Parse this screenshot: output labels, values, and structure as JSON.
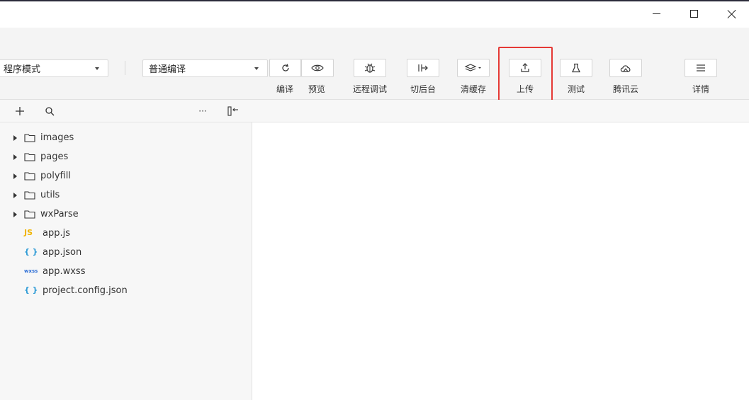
{
  "window": {
    "minimize_icon": "minimize-icon",
    "maximize_icon": "maximize-icon",
    "close_icon": "close-icon"
  },
  "toolbar": {
    "mode_select_value": "程序模式",
    "compile_select_value": "普通编译",
    "buttons": [
      {
        "label": "编译",
        "icon": "refresh-icon"
      },
      {
        "label": "预览",
        "icon": "eye-icon"
      },
      {
        "label": "远程调试",
        "icon": "bug-icon"
      },
      {
        "label": "切后台",
        "icon": "switch-background-icon"
      },
      {
        "label": "清缓存",
        "icon": "layers-icon"
      },
      {
        "label": "上传",
        "icon": "upload-icon"
      },
      {
        "label": "测试",
        "icon": "flask-icon"
      },
      {
        "label": "腾讯云",
        "icon": "cloud-icon"
      },
      {
        "label": "详情",
        "icon": "menu-icon"
      }
    ],
    "highlight_color": "#e53935"
  },
  "explorer": {
    "actions": {
      "add_icon": "plus-icon",
      "search_icon": "search-icon",
      "more_label": "···",
      "collapse_icon": "collapse-panel-icon"
    },
    "folders": [
      "images",
      "pages",
      "polyfill",
      "utils",
      "wxParse"
    ],
    "files": [
      {
        "badge": "JS",
        "name": "app.js",
        "badge_color": "#f0b400"
      },
      {
        "badge": "{ }",
        "name": "app.json",
        "badge_color": "#2e9bd6"
      },
      {
        "badge": "wxss",
        "name": "app.wxss",
        "badge_color": "#2e6fd6"
      },
      {
        "badge": "{ }",
        "name": "project.config.json",
        "badge_color": "#2e9bd6"
      }
    ]
  }
}
